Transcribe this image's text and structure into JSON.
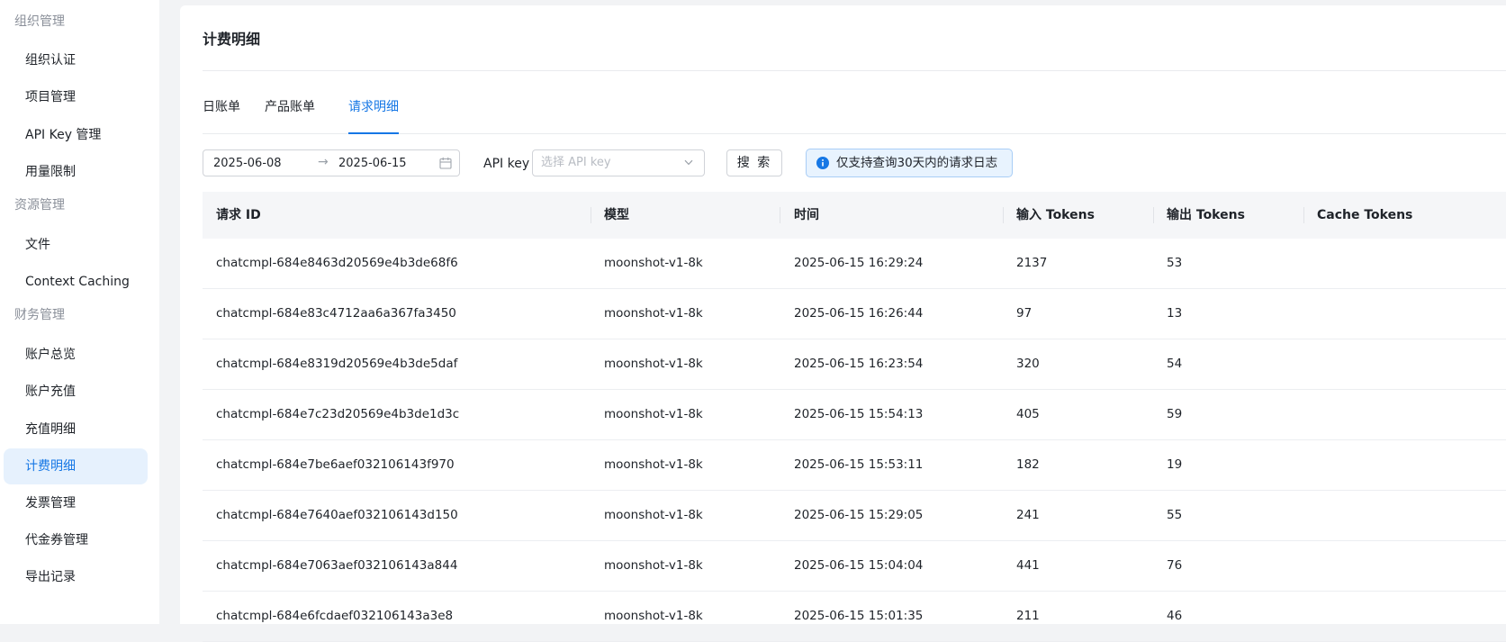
{
  "sidebar": {
    "groups": [
      {
        "title": "组织管理",
        "items": [
          "组织认证",
          "项目管理",
          "API Key 管理",
          "用量限制"
        ]
      },
      {
        "title": "资源管理",
        "items": [
          "文件",
          "Context Caching"
        ]
      },
      {
        "title": "财务管理",
        "items": [
          "账户总览",
          "账户充值",
          "充值明细",
          "计费明细",
          "发票管理",
          "代金券管理",
          "导出记录"
        ]
      }
    ],
    "active_item": "计费明细"
  },
  "page": {
    "title": "计费明细"
  },
  "tabs": [
    "日账单",
    "产品账单",
    "请求明细"
  ],
  "active_tab": "请求明细",
  "filters": {
    "date_start": "2025-06-08",
    "date_end": "2025-06-15",
    "arrow": "→",
    "api_key_label": "API key",
    "api_key_placeholder": "选择 API key",
    "search_label": "搜 索",
    "notice": "仅支持查询30天内的请求日志"
  },
  "table": {
    "columns": [
      "请求 ID",
      "模型",
      "时间",
      "输入 Tokens",
      "输出 Tokens",
      "Cache Tokens"
    ],
    "rows": [
      [
        "chatcmpl-684e8463d20569e4b3de68f6",
        "moonshot-v1-8k",
        "2025-06-15 16:29:24",
        "2137",
        "53",
        ""
      ],
      [
        "chatcmpl-684e83c4712aa6a367fa3450",
        "moonshot-v1-8k",
        "2025-06-15 16:26:44",
        "97",
        "13",
        ""
      ],
      [
        "chatcmpl-684e8319d20569e4b3de5daf",
        "moonshot-v1-8k",
        "2025-06-15 16:23:54",
        "320",
        "54",
        ""
      ],
      [
        "chatcmpl-684e7c23d20569e4b3de1d3c",
        "moonshot-v1-8k",
        "2025-06-15 15:54:13",
        "405",
        "59",
        ""
      ],
      [
        "chatcmpl-684e7be6aef032106143f970",
        "moonshot-v1-8k",
        "2025-06-15 15:53:11",
        "182",
        "19",
        ""
      ],
      [
        "chatcmpl-684e7640aef032106143d150",
        "moonshot-v1-8k",
        "2025-06-15 15:29:05",
        "241",
        "55",
        ""
      ],
      [
        "chatcmpl-684e7063aef032106143a844",
        "moonshot-v1-8k",
        "2025-06-15 15:04:04",
        "441",
        "76",
        ""
      ],
      [
        "chatcmpl-684e6fcdaef032106143a3e8",
        "moonshot-v1-8k",
        "2025-06-15 15:01:35",
        "211",
        "46",
        ""
      ]
    ]
  },
  "colors": {
    "accent": "#1677e5",
    "active_bg": "#e6f1fd",
    "notice_bg": "#e8f3fe",
    "notice_border": "#a8cdf6"
  }
}
